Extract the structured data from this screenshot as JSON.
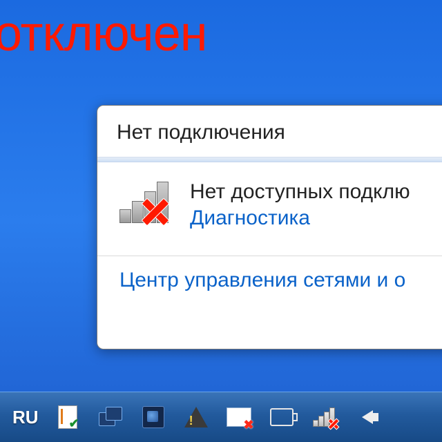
{
  "overlay_text": "отключен",
  "flyout": {
    "title": "Нет подключения",
    "status": "Нет доступных подклю",
    "diagnostics_link": "Диагностика",
    "sharing_center_link": "Центр управления сетями и о"
  },
  "taskbar": {
    "language": "RU"
  }
}
